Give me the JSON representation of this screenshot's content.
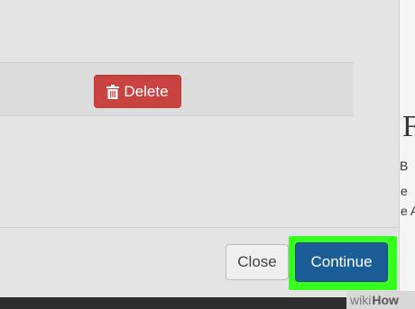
{
  "dialog": {
    "delete_label": "Delete",
    "close_label": "Close",
    "continue_label": "Continue"
  },
  "background_page": {
    "heading_fragment": "F",
    "line1": "B",
    "line2": "e",
    "line3": "e  A"
  },
  "watermark": {
    "wiki": "wiki",
    "how": "How"
  },
  "colors": {
    "delete_button": "#c94440",
    "continue_button": "#1b5d97",
    "highlight": "#36ff1f"
  },
  "icons": {
    "delete": "trash-icon"
  }
}
